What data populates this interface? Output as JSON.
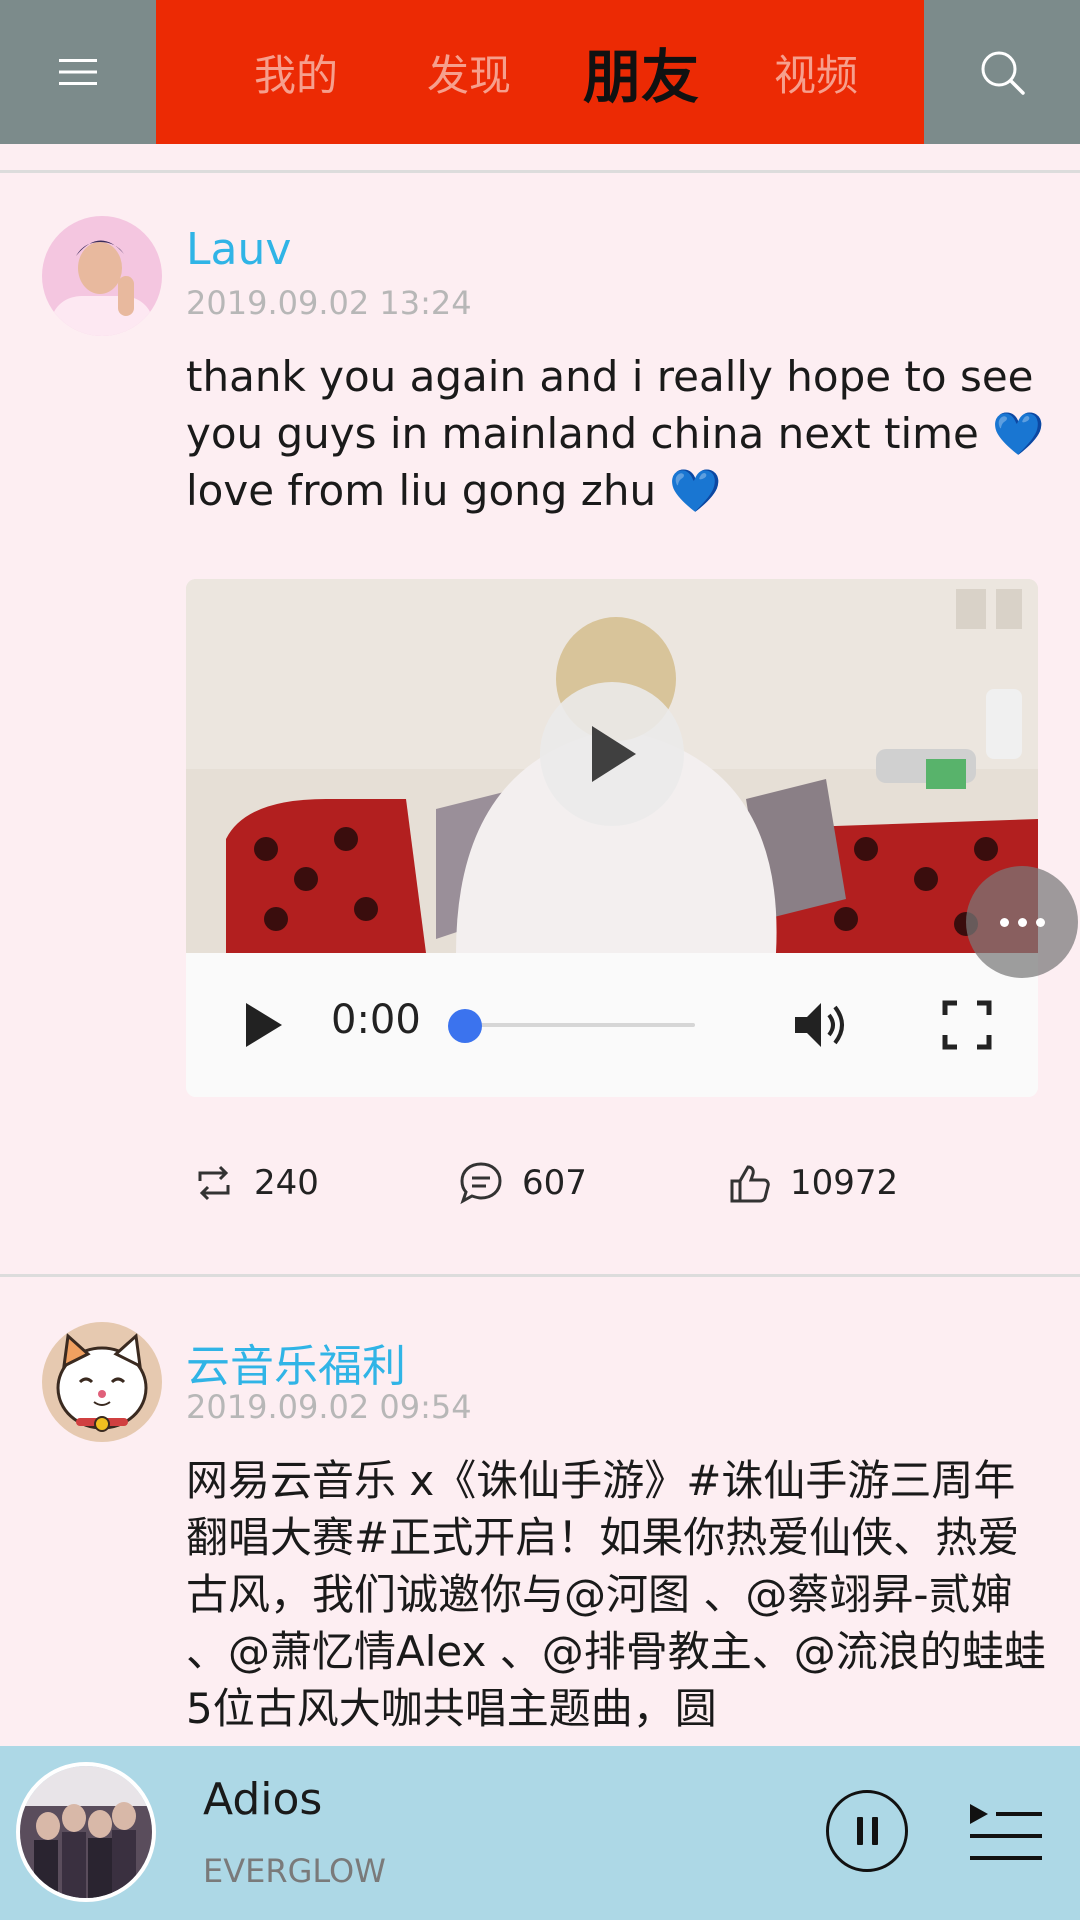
{
  "header": {
    "tabs": [
      {
        "label": "我的"
      },
      {
        "label": "发现"
      },
      {
        "label": "朋友"
      },
      {
        "label": "视频"
      }
    ],
    "active_tab": "朋友"
  },
  "posts": [
    {
      "author": "Lauv",
      "timestamp": "2019.09.02 13:24",
      "text": "thank you again and i really hope to see you guys in mainland china next time 💙 love from liu gong zhu 💙",
      "video": {
        "current_time": "0:00",
        "progress": 0.0
      },
      "actions": {
        "reposts": "240",
        "comments": "607",
        "likes": "10972"
      }
    },
    {
      "author": "云音乐福利",
      "timestamp": "2019.09.02 09:54",
      "text": "网易云音乐 x《诛仙手游》#诛仙手游三周年翻唱大赛#正式开启！如果你热爱仙侠、热爱古风，我们诚邀你与@河图 、@蔡翊昇-贰婶 、@萧忆情Alex 、@排骨教主、@流浪的蛙蛙 5位古风大咖共唱主题曲，圆"
    }
  ],
  "player": {
    "title": "Adios",
    "artist": "EVERGLOW"
  },
  "colors": {
    "tab_bar": "#ec2a04",
    "top_bar": "#7c8b8b",
    "author": "#30b4e6",
    "player_bg": "#add8e6",
    "progress_knob": "#3b73ee"
  },
  "icons": [
    "menu-icon",
    "search-icon",
    "play-icon",
    "volume-icon",
    "fullscreen-icon",
    "more-icon",
    "repost-icon",
    "comment-icon",
    "like-icon",
    "pause-icon",
    "playlist-icon"
  ]
}
